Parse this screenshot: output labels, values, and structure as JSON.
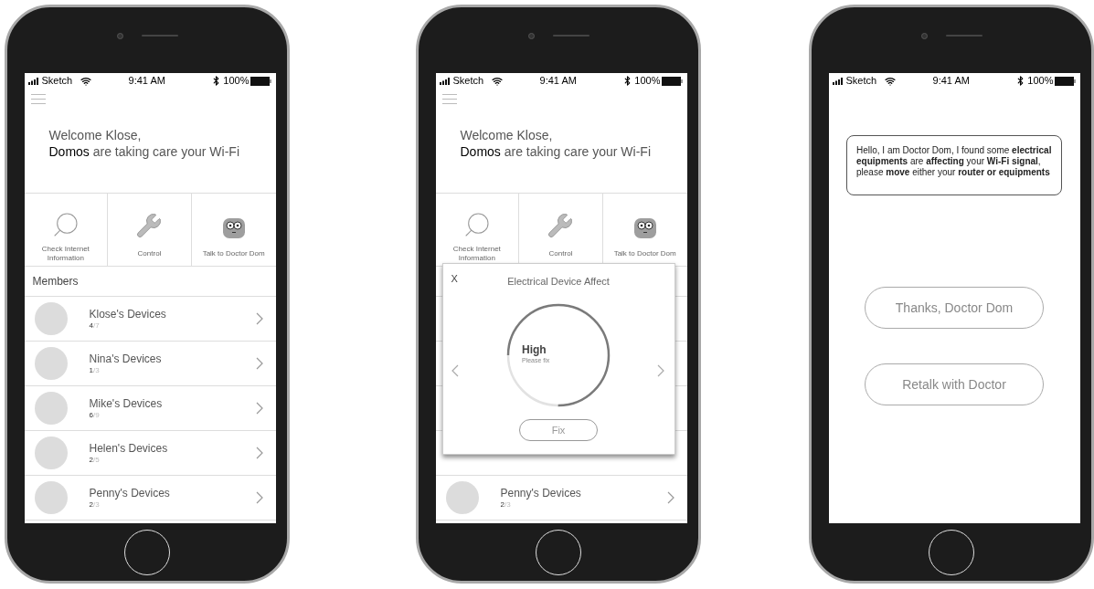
{
  "phones": [
    {
      "kind": "home",
      "status_bar": {
        "carrier": "Sketch",
        "time": "9:41 AM",
        "battery": "100%"
      },
      "welcome": {
        "line1": "Welcome Klose,",
        "line2": "**Domos** are taking care your Wi-Fi"
      },
      "actions": [
        {
          "label": "Check Internet Information"
        },
        {
          "label": "Control"
        },
        {
          "label": "Talk to Doctor Dom"
        }
      ],
      "members": {
        "title": "Members",
        "rows": [
          {
            "name": "Klose's Devices",
            "count": "4",
            "total": "/7"
          },
          {
            "name": "Nina's Devices",
            "count": "1",
            "total": "/3"
          },
          {
            "name": "Mike's Devices",
            "count": "6",
            "total": "/9"
          },
          {
            "name": "Helen's Devices",
            "count": "2",
            "total": "/5"
          },
          {
            "name": "Penny's Devices",
            "count": "2",
            "total": "/3"
          }
        ]
      }
    },
    {
      "kind": "dialog",
      "status_bar": {
        "carrier": "Sketch",
        "time": "9:41 AM",
        "battery": "100%"
      },
      "welcome": {
        "line1": "Welcome Klose,",
        "line2": "**Domos** are taking care your Wi-Fi"
      },
      "actions": [
        {
          "label": "Check Internet Information"
        },
        {
          "label": "Control"
        },
        {
          "label": "Talk to Doctor Dom"
        }
      ],
      "members": {
        "rows": [
          {
            "name": "Penny's Devices",
            "count": "2",
            "total": "/3"
          }
        ]
      },
      "dialog": {
        "close": "X",
        "title": "Electrical Device Affect",
        "gauge": {
          "level": 0.75,
          "reading": "High",
          "hint": "Please fix"
        },
        "button": "Fix"
      }
    },
    {
      "kind": "chat",
      "status_bar": {
        "carrier": "Sketch",
        "time": "9:41 AM",
        "battery": "100%"
      },
      "message": "Hello, I am Doctor Dom, I found some **electrical equipments** are **affecting** your **Wi-Fi signal**, please **move** either your **router or equipments**",
      "buttons": [
        "Thanks, Doctor Dom",
        "Retalk with Doctor"
      ]
    }
  ]
}
